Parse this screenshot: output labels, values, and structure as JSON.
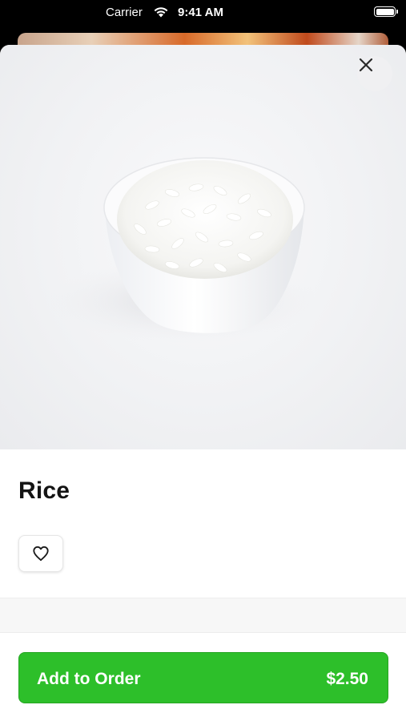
{
  "status_bar": {
    "carrier": "Carrier",
    "time": "9:41 AM"
  },
  "modal": {
    "image_alt": "Bowl of white rice",
    "close_icon": "close-icon",
    "title": "Rice",
    "favorite_icon": "heart-icon"
  },
  "footer": {
    "add_label": "Add to Order",
    "price": "$2.50"
  },
  "colors": {
    "accent": "#2dbf2a",
    "text": "#141414"
  }
}
